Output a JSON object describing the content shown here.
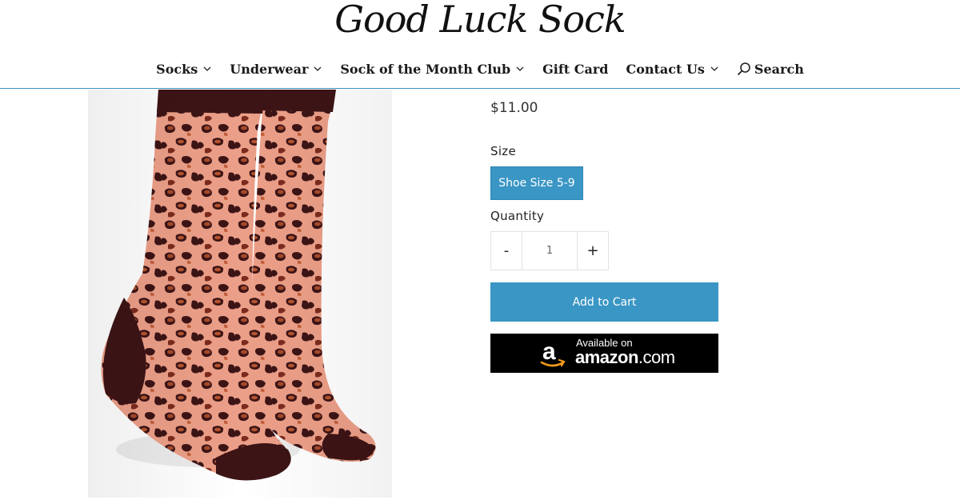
{
  "brand": {
    "logo_text": "Good Luck Sock"
  },
  "nav": {
    "items": [
      {
        "label": "Socks",
        "has_dropdown": true
      },
      {
        "label": "Underwear",
        "has_dropdown": true
      },
      {
        "label": "Sock of the Month Club",
        "has_dropdown": true
      },
      {
        "label": "Gift Card",
        "has_dropdown": false
      },
      {
        "label": "Contact Us",
        "has_dropdown": true
      }
    ],
    "search_label": "Search"
  },
  "product": {
    "price": "$11.00",
    "size_label": "Size",
    "size_option": "Shoe Size 5-9",
    "quantity_label": "Quantity",
    "quantity_minus": "-",
    "quantity_value": "1",
    "quantity_plus": "+",
    "add_to_cart": "Add to Cart",
    "amazon_badge": {
      "line1": "Available on",
      "line2_bold": "amazon",
      "line2_suffix": ".com"
    }
  },
  "colors": {
    "accent": "#3a96c4",
    "rule": "#3b8fbf",
    "sock_base": "#e8a08a",
    "sock_dark": "#3d1416",
    "sock_spot": "#a54a2a"
  }
}
